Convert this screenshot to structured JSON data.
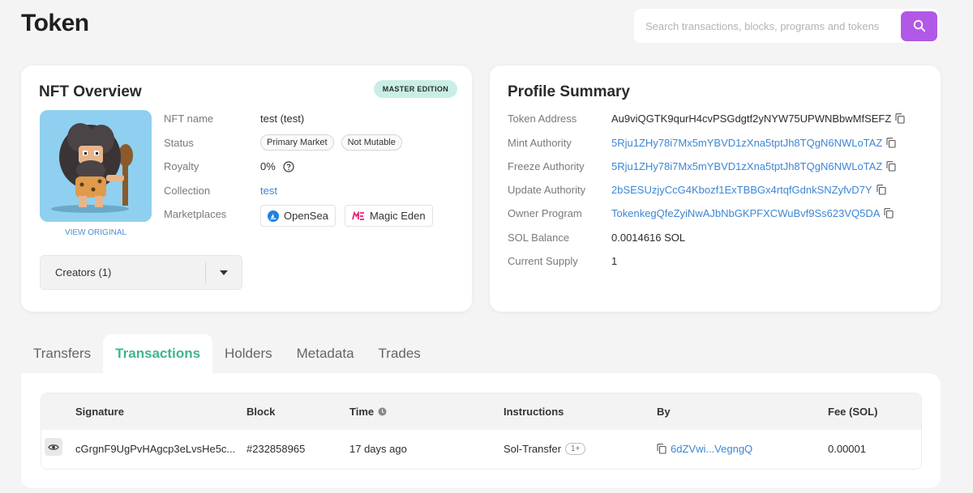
{
  "page": {
    "title": "Token"
  },
  "search": {
    "placeholder": "Search transactions, blocks, programs and tokens"
  },
  "colors": {
    "accent": "#b258e6",
    "link": "#3d86d4",
    "active_tab": "#3fb68c",
    "badge_bg": "#c9eee6"
  },
  "nft_overview": {
    "title": "NFT Overview",
    "badge": "MASTER EDITION",
    "view_original": "VIEW ORIGINAL",
    "creators_label": "Creators (1)",
    "fields": {
      "name_label": "NFT name",
      "name_value": "test (test)",
      "status_label": "Status",
      "status_pills": [
        "Primary Market",
        "Not Mutable"
      ],
      "royalty_label": "Royalty",
      "royalty_value": "0%",
      "collection_label": "Collection",
      "collection_value": "test",
      "marketplaces_label": "Marketplaces",
      "marketplaces": [
        "OpenSea",
        "Magic Eden"
      ]
    }
  },
  "profile_summary": {
    "title": "Profile Summary",
    "rows": [
      {
        "label": "Token Address",
        "value": "Au9viQGTK9qurH4cvPSGdgtf2yNYW75UPWNBbwMfSEFZ"
      },
      {
        "label": "Mint Authority",
        "value": "5Rju1ZHy78i7Mx5mYBVD1zXna5tptJh8TQgN6NWLoTAZ"
      },
      {
        "label": "Freeze Authority",
        "value": "5Rju1ZHy78i7Mx5mYBVD1zXna5tptJh8TQgN6NWLoTAZ"
      },
      {
        "label": "Update Authority",
        "value": "2bSESUzjyCcG4Kbozf1ExTBBGx4rtqfGdnkSNZyfvD7Y"
      },
      {
        "label": "Owner Program",
        "value": "TokenkegQfeZyiNwAJbNbGKPFXCWuBvf9Ss623VQ5DA"
      },
      {
        "label": "SOL Balance",
        "value": "0.0014616 SOL"
      },
      {
        "label": "Current Supply",
        "value": "1"
      }
    ]
  },
  "tabs": [
    "Transfers",
    "Transactions",
    "Holders",
    "Metadata",
    "Trades"
  ],
  "table": {
    "headers": {
      "signature": "Signature",
      "block": "Block",
      "time": "Time",
      "instructions": "Instructions",
      "by": "By",
      "fee": "Fee (SOL)"
    },
    "rows": [
      {
        "signature": "cGrgnF9UgPvHAgcp3eLvsHe5c...",
        "block": "#232858965",
        "time": "17 days ago",
        "instruction": "Sol-Transfer",
        "instruction_count": "1+",
        "by": "6dZVwi...VegngQ",
        "fee": "0.00001"
      }
    ]
  }
}
